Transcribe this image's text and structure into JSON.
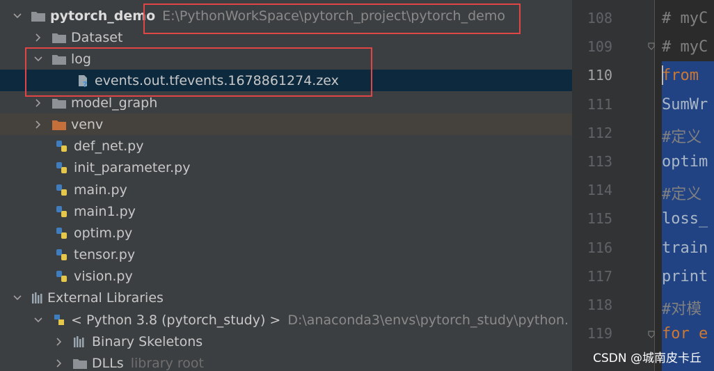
{
  "tree": {
    "root": {
      "label": "pytorch_demo",
      "path": "E:\\PythonWorkSpace\\pytorch_project\\pytorch_demo"
    },
    "dataset": {
      "label": "Dataset"
    },
    "log": {
      "label": "log"
    },
    "log_file": {
      "label": "events.out.tfevents.1678861274.zex"
    },
    "model_graph": {
      "label": "model_graph"
    },
    "venv": {
      "label": "venv"
    },
    "files": [
      {
        "label": "def_net.py"
      },
      {
        "label": "init_parameter.py"
      },
      {
        "label": "main.py"
      },
      {
        "label": "main1.py"
      },
      {
        "label": "optim.py"
      },
      {
        "label": "tensor.py"
      },
      {
        "label": "vision.py"
      }
    ],
    "external": {
      "label": "External Libraries"
    },
    "python_sdk": {
      "label": "< Python 3.8 (pytorch_study) >",
      "path": "D:\\anaconda3\\envs\\pytorch_study\\python."
    },
    "binary": {
      "label": "Binary Skeletons"
    },
    "dlls": {
      "label": "DLLs",
      "hint": "library root"
    }
  },
  "editor": {
    "line_numbers": [
      "108",
      "109",
      "110",
      "111",
      "112",
      "113",
      "114",
      "115",
      "116",
      "117",
      "118",
      "119"
    ],
    "current_line": "110",
    "lines": [
      "# myC",
      "# myC",
      "from",
      "SumWr",
      "#定义",
      "optim",
      "#定义",
      "loss_",
      "train",
      "print",
      "#对模",
      "for e"
    ]
  },
  "watermark": "CSDN @城南皮卡丘",
  "colors": {
    "selection": "#0d293e",
    "highlight_box": "#e04646",
    "folder_excluded": "#c5703a"
  }
}
